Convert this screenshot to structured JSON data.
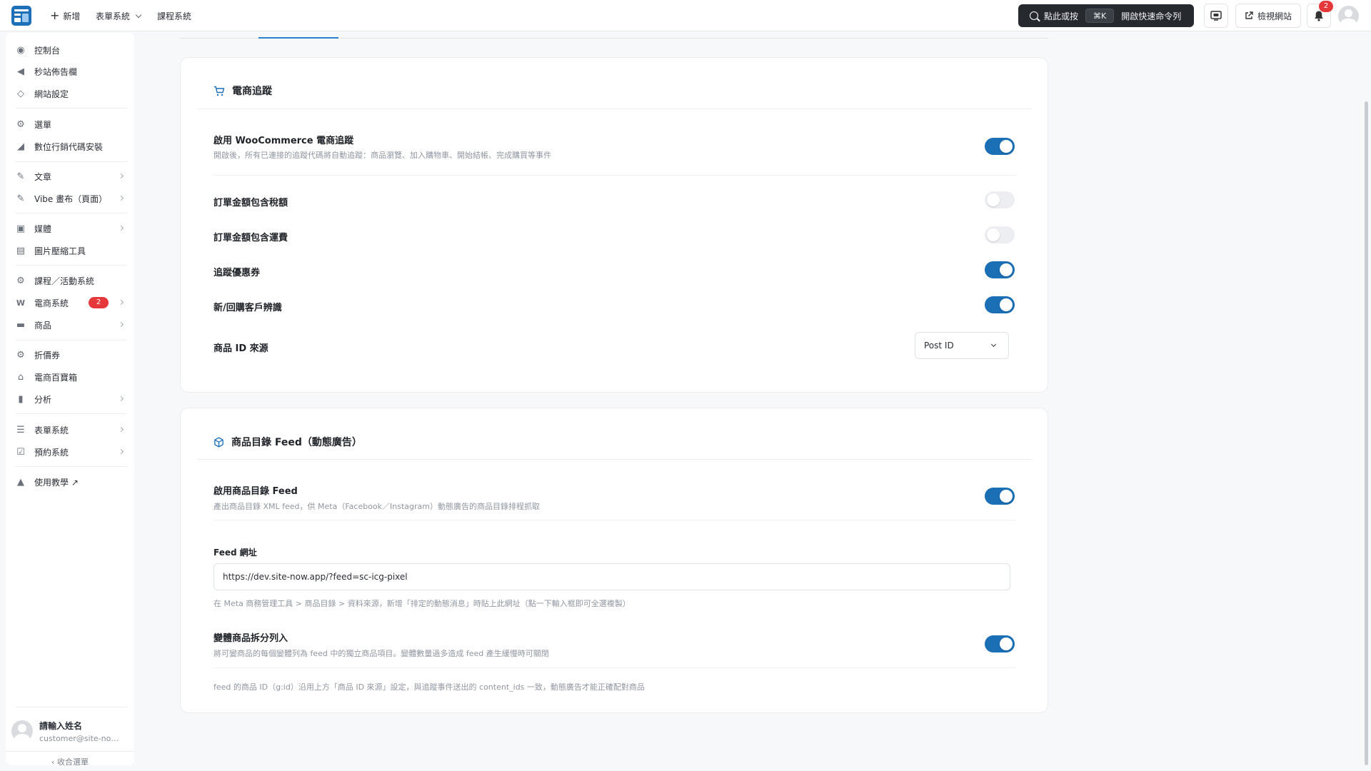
{
  "topbar": {
    "new_label": "新增",
    "forms_label": "表單系統",
    "courses_label": "課程系統",
    "command_prefix": "點此或按",
    "command_kbd": "⌘K",
    "command_suffix": "開啟快速命令列",
    "preview_label": "檢視網站",
    "notification_count": "2"
  },
  "sidebar": {
    "items": [
      {
        "label": "控制台",
        "icon": "dashboard-icon"
      },
      {
        "label": "秒站佈告欄",
        "icon": "megaphone-icon"
      },
      {
        "label": "網站設定",
        "icon": "diamond-icon"
      },
      {
        "label": "選單",
        "icon": "gear-icon"
      },
      {
        "label": "數位行銷代碼安裝",
        "icon": "chart-icon"
      },
      {
        "label": "文章",
        "icon": "pin-icon"
      },
      {
        "label": "Vibe 畫布（頁面）",
        "icon": "pin-icon"
      },
      {
        "label": "媒體",
        "icon": "media-icon"
      },
      {
        "label": "圖片壓縮工具",
        "icon": "image-compress-icon"
      },
      {
        "label": "課程／活動系統",
        "icon": "gear-icon"
      },
      {
        "label": "電商系統",
        "icon": "woo-icon",
        "badge": "2"
      },
      {
        "label": "商品",
        "icon": "box-icon"
      },
      {
        "label": "折價券",
        "icon": "gear-icon"
      },
      {
        "label": "電商百寶箱",
        "icon": "store-icon"
      },
      {
        "label": "分析",
        "icon": "bar-chart-icon"
      },
      {
        "label": "表單系統",
        "icon": "form-icon"
      },
      {
        "label": "預約系統",
        "icon": "calendar-icon"
      },
      {
        "label": "使用教學 ↗",
        "icon": "graduation-icon"
      }
    ],
    "user_name": "請輸入姓名",
    "user_email": "customer@site-now.app",
    "collapse_label": "收合選單"
  },
  "ecommerce": {
    "title": "電商追蹤",
    "enable_label": "啟用 WooCommerce 電商追蹤",
    "enable_desc": "開啟後，所有已連接的追蹤代碼將自動追蹤：商品瀏覽、加入購物車、開始結帳、完成購買等事件",
    "enable_on": true,
    "tax_label": "訂單金額包含稅額",
    "tax_on": false,
    "shipping_label": "訂單金額包含運費",
    "shipping_on": false,
    "coupon_label": "追蹤優惠券",
    "coupon_on": true,
    "customer_label": "新/回購客戶辨識",
    "customer_on": true,
    "product_id_label": "商品 ID 來源",
    "product_id_value": "Post ID"
  },
  "feed": {
    "title": "商品目錄 Feed（動態廣告）",
    "enable_label": "啟用商品目錄 Feed",
    "enable_desc": "產出商品目錄 XML feed，供 Meta（Facebook／Instagram）動態廣告的商品目錄排程抓取",
    "enable_on": true,
    "url_label": "Feed 網址",
    "url_value": "https://dev.site-now.app/?feed=sc-icg-pixel",
    "url_hint": "在 Meta 商務管理工具 > 商品目錄 > 資料來源，新增「排定的動態消息」時貼上此網址（點一下輸入框即可全選複製）",
    "variation_label": "變體商品拆分列入",
    "variation_desc": "將可變商品的每個變體列為 feed 中的獨立商品項目。變體數量過多造成 feed 產生緩慢時可關閉",
    "variation_on": true,
    "footnote": "feed 的商品 ID（g:id）沿用上方「商品 ID 來源」設定，與追蹤事件送出的 content_ids 一致，動態廣告才能正確配對商品"
  }
}
